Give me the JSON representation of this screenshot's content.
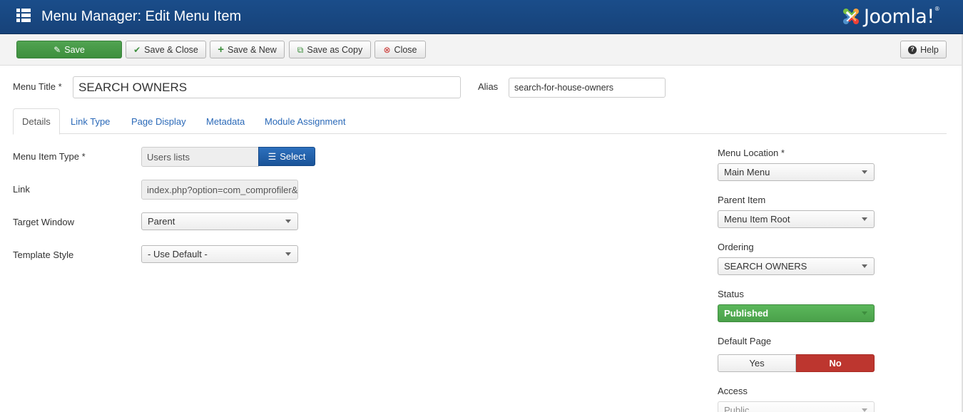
{
  "header": {
    "title": "Menu Manager: Edit Menu Item",
    "logo_text": "Joomla!",
    "logo_mark": "®"
  },
  "toolbar": {
    "save_label": "Save",
    "save_close_label": "Save & Close",
    "save_new_label": "Save & New",
    "save_copy_label": "Save as Copy",
    "close_label": "Close",
    "help_label": "Help"
  },
  "form": {
    "menu_title_label": "Menu Title *",
    "menu_title_value": "SEARCH OWNERS",
    "alias_label": "Alias",
    "alias_value": "search-for-house-owners"
  },
  "tabs": [
    "Details",
    "Link Type",
    "Page Display",
    "Metadata",
    "Module Assignment"
  ],
  "details": {
    "item_type_label": "Menu Item Type *",
    "item_type_value": "Users lists",
    "select_label": "Select",
    "link_label": "Link",
    "link_value": "index.php?option=com_comprofiler&",
    "target_label": "Target Window",
    "target_value": "Parent",
    "template_label": "Template Style",
    "template_value": "- Use Default -"
  },
  "sidebar": {
    "location_label": "Menu Location *",
    "location_value": "Main Menu",
    "parent_label": "Parent Item",
    "parent_value": "Menu Item Root",
    "ordering_label": "Ordering",
    "ordering_value": "SEARCH OWNERS",
    "status_label": "Status",
    "status_value": "Published",
    "default_label": "Default Page",
    "default_yes": "Yes",
    "default_no": "No",
    "access_label": "Access",
    "access_value": "Public"
  },
  "colors": {
    "header_bg": "#174279",
    "save_green": "#46a546",
    "select_blue": "#1f5fa8",
    "published_green": "#4fa94f",
    "no_red": "#bd362f",
    "link_blue": "#2a69b8"
  }
}
